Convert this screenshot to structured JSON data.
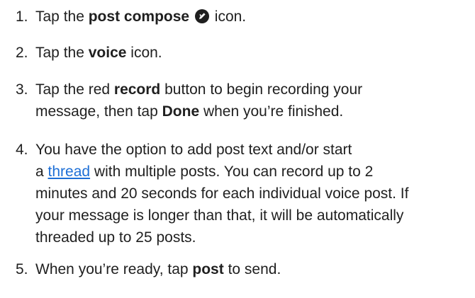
{
  "steps": [
    {
      "number": "1.",
      "before": "Tap the ",
      "bold": "post compose",
      "icon": "post-compose-icon",
      "after": "icon."
    },
    {
      "number": "2.",
      "before": "Tap the ",
      "bold": "voice",
      "after": " icon."
    },
    {
      "number": "3.",
      "line1_before": "Tap the red ",
      "line1_bold": "record",
      "line1_after": " button to begin recording your",
      "line2_before": "message, then tap ",
      "line2_bold": "Done",
      "line2_after": " when you’re finished."
    },
    {
      "number": "4.",
      "line1": "You have the option to add post text and/or start",
      "line2_before": "a ",
      "line2_link": "thread",
      "line2_after": " with multiple posts. You can record up to 2",
      "line3": "minutes and 20 seconds for each individual voice post. If",
      "line4": "your message is longer than that, it will be automatically",
      "line5": "threaded up to 25 posts."
    },
    {
      "number": "5.",
      "before": "When you’re ready, tap ",
      "bold": "post",
      "after": " to send."
    }
  ]
}
